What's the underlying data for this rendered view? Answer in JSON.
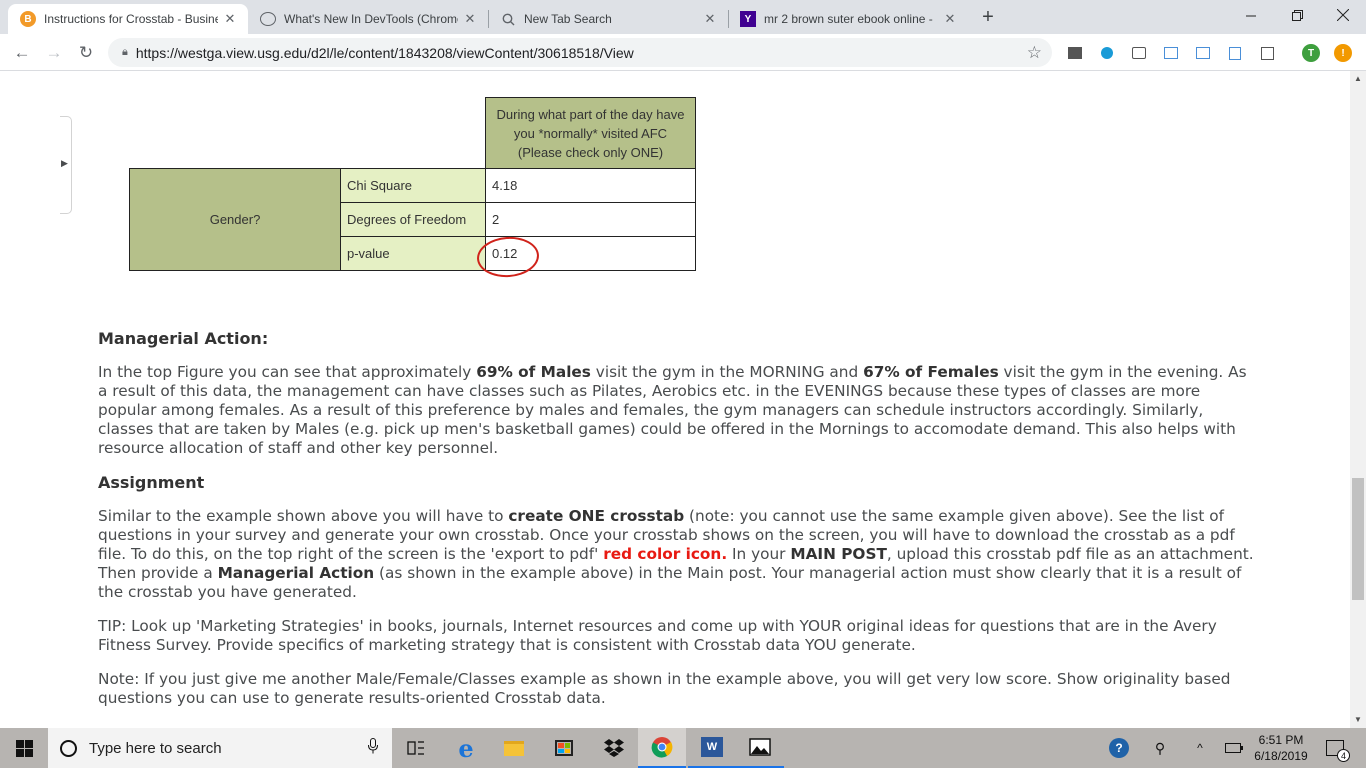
{
  "browser": {
    "tabs": [
      {
        "title": "Instructions for Crosstab - Busine",
        "favicon": "brightspace-icon",
        "active": true
      },
      {
        "title": "What's New In DevTools (Chrome",
        "favicon": "globe-icon",
        "active": false
      },
      {
        "title": "New Tab Search",
        "favicon": "search-icon",
        "active": false
      },
      {
        "title": "mr 2 brown suter ebook online -",
        "favicon": "yahoo-icon",
        "active": false
      }
    ],
    "new_tab_symbol": "+",
    "url": "https://westga.view.usg.edu/d2l/le/content/1843208/viewContent/30618518/View",
    "profile_letter": "T",
    "update_symbol": "!"
  },
  "crosstab": {
    "column_header": "During what part of the day have you *normally* visited AFC (Please check only ONE)",
    "row_header": "Gender?",
    "rows": [
      {
        "stat": "Chi Square",
        "value": "4.18"
      },
      {
        "stat": "Degrees of Freedom",
        "value": "2"
      },
      {
        "stat": "p-value",
        "value": "0.12"
      }
    ]
  },
  "article": {
    "managerial_heading": "Managerial Action:",
    "managerial_p": {
      "t1": "In the top Figure you can see that approximately ",
      "b1": "69% of Males",
      "t2": " visit the gym in the MORNING and ",
      "b2": "67% of Females",
      "t3": " visit the gym in the evening. As a result of this data, the management can have classes such as Pilates, Aerobics etc. in the EVENINGS because these types of classes are more popular among females. As a result of this preference by males and females, the gym managers can schedule instructors accordingly. Similarly, classes that are taken by Males (e.g. pick up men's basketball games) could be offered in the Mornings to accomodate demand. This also helps with resource allocation of staff and other key personnel."
    },
    "assignment_heading": "Assignment",
    "assignment_p": {
      "t1": "Similar to the example shown above you will have to ",
      "b1": "create ONE crosstab",
      "t2": " (note: you cannot use the same example given above). See the list of questions in your survey and generate your own crosstab. Once your crosstab shows on the screen, you will have to download the crosstab as a pdf file. To do this, on the top right of the screen is the 'export to pdf' ",
      "red": "red color icon.",
      "t3": " In your ",
      "b2": "MAIN POST",
      "t4": ", upload this crosstab pdf file as an attachment. Then provide a ",
      "b3": "Managerial Action",
      "t5": " (as shown in the example above) in the Main post. Your managerial action must show clearly that it is a result of the crosstab you have generated."
    },
    "tip": "TIP: Look up 'Marketing Strategies' in books, journals, Internet resources and come up with YOUR original ideas for questions that are in the Avery Fitness Survey. Provide specifics of marketing strategy that is consistent with Crosstab data YOU generate.",
    "note": "Note: If you just give me another Male/Female/Classes example as shown in the example above, you will get very low score. Show originality based questions you can use to generate results-oriented Crosstab data."
  },
  "taskbar": {
    "search_placeholder": "Type here to search",
    "time": "6:51 PM",
    "date": "6/18/2019",
    "notification_count": "4"
  },
  "colors": {
    "crosstab_header": "#b5c08a",
    "crosstab_stat": "#e5f0c4",
    "highlight_circle": "#d0231b",
    "red_text": "#e81a12"
  }
}
